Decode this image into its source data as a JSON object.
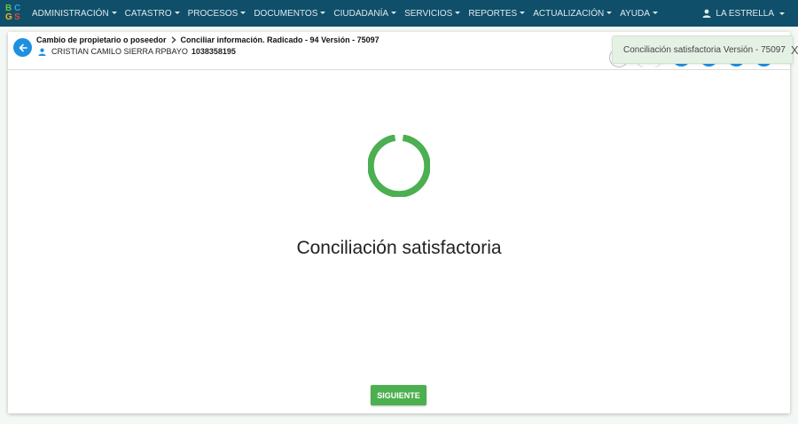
{
  "navbar": {
    "logo_letters": [
      "B",
      "C",
      "G",
      "S"
    ],
    "items": [
      {
        "label": "ADMINISTRACIÓN"
      },
      {
        "label": "CATASTRO"
      },
      {
        "label": "PROCESOS"
      },
      {
        "label": "DOCUMENTOS"
      },
      {
        "label": "CIUDADANÍA"
      },
      {
        "label": "SERVICIOS"
      },
      {
        "label": "REPORTES"
      },
      {
        "label": "ACTUALIZACIÓN"
      },
      {
        "label": "AYUDA"
      }
    ],
    "user_label": "LA ESTRELLA"
  },
  "header": {
    "breadcrumb_parent": "Cambio de propietario o poseedor",
    "breadcrumb_current": "Conciliar información. Radicado - 94 Versión - 75097",
    "person_name": "CRISTIAN CAMILO SIERRA RPBAYO",
    "person_id": "1038358195"
  },
  "toast": {
    "message": "Conciliación satisfactoria Versión - 75097",
    "close_label": "X"
  },
  "main": {
    "status_title": "Conciliación satisfactoria",
    "next_button": "SIGUIENTE"
  },
  "colors": {
    "navbar": "#0f4f69",
    "accent_blue": "#1e90e0",
    "success_green": "#4caf50",
    "toast_bg": "#e6f1e6"
  }
}
